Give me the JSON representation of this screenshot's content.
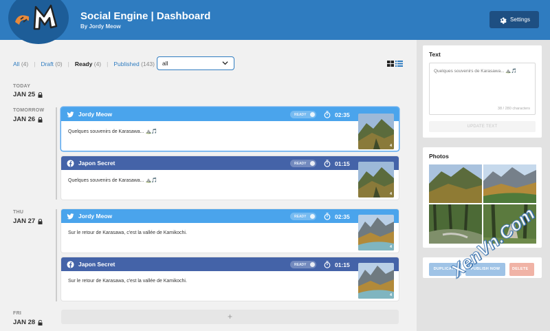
{
  "header": {
    "title": "Social Engine | Dashboard",
    "subtitle": "By Jordy Meow",
    "settings_label": "Settings"
  },
  "filters": {
    "items": [
      {
        "label": "All",
        "count": "(4)"
      },
      {
        "label": "Draft",
        "count": "(0)"
      },
      {
        "label": "Ready",
        "count": "(4)"
      },
      {
        "label": "Published",
        "count": "(143)"
      }
    ],
    "active": "Ready",
    "select_value": "all"
  },
  "days": [
    {
      "label": "TODAY",
      "date": "JAN 25"
    },
    {
      "label": "TOMORROW",
      "date": "JAN 26"
    },
    {
      "label": "THU",
      "date": "JAN 27"
    },
    {
      "label": "FRI",
      "date": "JAN 28"
    }
  ],
  "posts": [
    {
      "account": "Jordy Meow",
      "network": "twitter",
      "status": "READY",
      "time": "02:35",
      "text": "Quelques souvenirs de Karasawa... ⛰️🎵",
      "photo_count": "4"
    },
    {
      "account": "Japon Secret",
      "network": "facebook",
      "status": "READY",
      "time": "01:15",
      "text": "Quelques souvenirs de Karasawa... ⛰️🎵",
      "photo_count": "4"
    },
    {
      "account": "Jordy Meow",
      "network": "twitter",
      "status": "READY",
      "time": "02:35",
      "text": "Sur le retour de Karasawa, c'est la vallée de Kamikochi.",
      "photo_count": "4"
    },
    {
      "account": "Japon Secret",
      "network": "facebook",
      "status": "READY",
      "time": "01:15",
      "text": "Sur le retour de Karasawa, c'est la vallée de Kamikochi.",
      "photo_count": "4"
    }
  ],
  "add_slot_label": "+",
  "sidebar": {
    "text_panel": {
      "title": "Text",
      "value": "Quelques souvenirs de Karasawa... ⛰️🎵",
      "char_count": "38 / 280 characters",
      "update_label": "UPDATE TEXT"
    },
    "photos_panel": {
      "title": "Photos"
    },
    "actions": {
      "duplicate_label": "DUPLICATE",
      "publish_label": "PUBLISH NOW",
      "delete_label": "DELETE"
    }
  },
  "watermark": "XenVn.Com",
  "colors": {
    "header": "#2f7cc0",
    "twitter": "#4aa4ec",
    "facebook": "#4463a8",
    "accent": "#2f7cc0"
  }
}
